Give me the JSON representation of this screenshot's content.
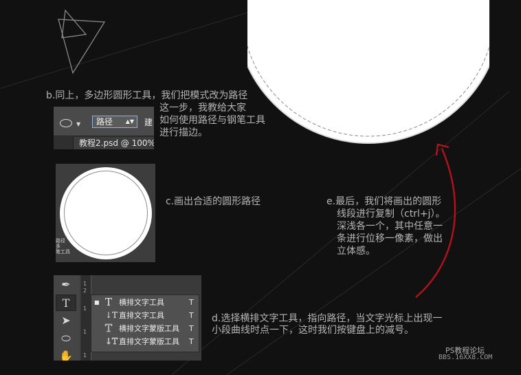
{
  "step_b": {
    "heading": "b.同上，多边形圆形工具，我们把模式改为路径",
    "lines": [
      "这一步，我教给大家",
      "如何使用路径与钢笔工具",
      "进行描边。"
    ]
  },
  "toolbar": {
    "mode_value": "路径",
    "next_label_fragment": "建",
    "doc_tab": "教程2.psd @ 100%"
  },
  "step_c": {
    "text": "c.画出合适的圆形路径"
  },
  "circle_fragment": [
    "路径",
    "多",
    "笔工具"
  ],
  "step_d": {
    "line1": "d.选择横排文字工具，指向路径，当文字光标上出现一",
    "line2": "小段曲线时点一下，这时我们按键盘上的减号。"
  },
  "step_e": {
    "lines": [
      "e.最后，我们将画出的圆形",
      "线段进行复制（ctrl+j）。",
      "深浅各一个，其中任意一",
      "条进行位移一像素，做出",
      "立体感。"
    ]
  },
  "tools": {
    "ruler": [
      "1",
      "2",
      "1",
      "1",
      "1"
    ],
    "menu": [
      {
        "label": "横排文字工具",
        "key": "T",
        "icon": "T",
        "active": true
      },
      {
        "label": "直排文字工具",
        "key": "T",
        "icon": "↓T",
        "active": false
      },
      {
        "label": "横排文字蒙版工具",
        "key": "T",
        "icon": "T",
        "active": false
      },
      {
        "label": "直排文字蒙版工具",
        "key": "T",
        "icon": "↓T",
        "active": false
      }
    ],
    "left_icons": [
      "pen-tool-icon",
      "type-tool-icon",
      "path-select-icon",
      "ellipse-tool-icon",
      "hand-tool-icon"
    ]
  },
  "credit": {
    "line1": "PS教程论坛",
    "line2": "BBS.16XX8.COM"
  },
  "colors": {
    "background": "#111111",
    "arrow": "#b0121c",
    "text": "#b5b5b5"
  }
}
